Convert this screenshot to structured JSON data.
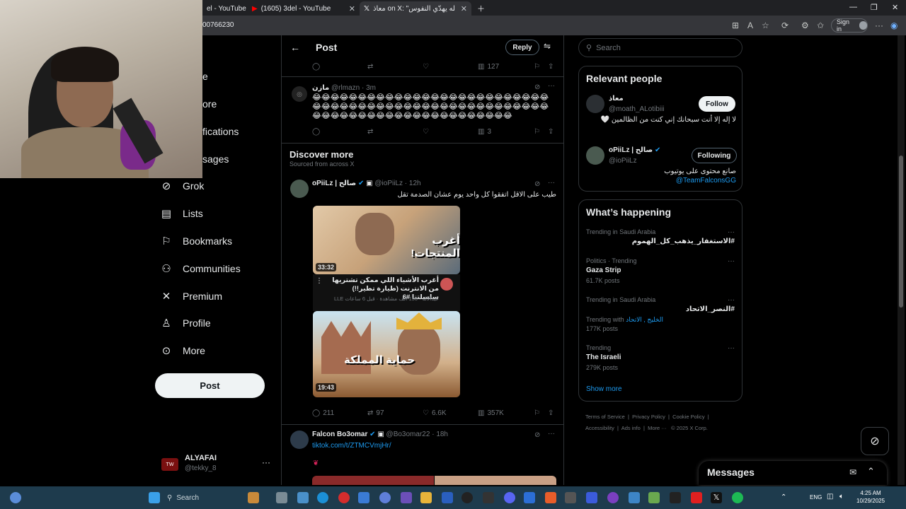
{
  "browser": {
    "tabs": [
      {
        "title": "el - YouTube",
        "icon": "youtube-icon"
      },
      {
        "title": "(1605) 3del - YouTube",
        "icon": "youtube-icon"
      },
      {
        "title": "معاذ on X: \"الله يهدّي النفوس\"",
        "icon": "x-icon"
      }
    ],
    "url": "00766230",
    "sign_in": "Sign in"
  },
  "sidebar": {
    "clipped_items": [
      "e",
      "ore",
      "fications",
      "sages"
    ],
    "items": [
      {
        "label": "Grok",
        "icon": "grok-icon"
      },
      {
        "label": "Lists",
        "icon": "list-icon"
      },
      {
        "label": "Bookmarks",
        "icon": "bookmark-icon"
      },
      {
        "label": "Communities",
        "icon": "communities-icon"
      },
      {
        "label": "Premium",
        "icon": "x-logo-icon"
      },
      {
        "label": "Profile",
        "icon": "profile-icon"
      },
      {
        "label": "More",
        "icon": "more-circle-icon"
      }
    ],
    "post_button": "Post",
    "account": {
      "name": "ALYAFAI",
      "handle": "@tekky_8"
    }
  },
  "header": {
    "title": "Post",
    "reply_button": "Reply"
  },
  "top_actions": {
    "views": "127"
  },
  "reply_tweet": {
    "name": "مازن",
    "handle": "@rlmazn",
    "time": "3m",
    "text": "😂😂😂😂😂😂😂😂😂😂😂😂😂😂😂😂😂😂😂😂😂😂😂😂😂😂😂😂😂😂😂😂😂😂😂😂😂😂😂😂😂😂😂😂😂😂😂😂😂😂😂😂😂😂😂😂😂😂😂😂😂😂😂😂😂😂😂😂😂😂😂😂😂😂",
    "views": "3"
  },
  "discover": {
    "title": "Discover more",
    "subtitle": "Sourced from across X"
  },
  "tweet1": {
    "name": "oPiiLz | صالح",
    "handle": "@ioPiiLz",
    "time": "12h",
    "text": "طيب على الاقل اتفقوا كل واحد يوم عشان الصدمة تقل",
    "video1": {
      "duration": "33:32",
      "title": "أغرب الأشياء اللي ممكن تشتريها من الانترنت (طيارة تطير!!) سلسلتنا #6",
      "meta": "عبدالاله · 156 ألف مشاهدة · قبل 6 ساعات LLE",
      "thumb_text": "أغرب المنتجات!"
    },
    "video2": {
      "duration": "19:43",
      "thumb_text": "حماية المملكة"
    },
    "replies": "211",
    "reposts": "97",
    "likes": "6.6K",
    "views": "357K"
  },
  "tweet2": {
    "name": "Falcon Bo3omar",
    "handle": "@Bo3omar22",
    "time": "18h",
    "link": "tiktok.com/t/ZTMCVmjHr/"
  },
  "right": {
    "search_placeholder": "Search",
    "relevant_people": {
      "title": "Relevant people",
      "people": [
        {
          "name": "معاذ",
          "handle": "@moath_ALotibiii",
          "bio": "لا إله إلا أنت سبحانك إني كنت من الظالمين 🤍",
          "button": "Follow"
        },
        {
          "name": "oPiiLz | صالح",
          "handle": "@ioPiiLz",
          "bio": "صانع محتوى على يوتيوب",
          "bio_link": "@TeamFalconsGG",
          "button": "Following"
        }
      ]
    },
    "happening": {
      "title": "What’s happening",
      "trends": [
        {
          "category": "Trending in Saudi Arabia",
          "name": "#الاستغفار_يذهب_كل_الهموم",
          "posts": ""
        },
        {
          "category": "Politics · Trending",
          "name": "Gaza Strip",
          "posts": "61.7K posts"
        },
        {
          "category": "Trending in Saudi Arabia",
          "name": "#النصر_الاتحاد",
          "with_label": "Trending with",
          "with_links": "الخليج , الاتحاد",
          "posts": "177K posts"
        },
        {
          "category": "Trending",
          "name": "The Israeli",
          "posts": "279K posts"
        }
      ],
      "show_more": "Show more"
    },
    "footer": [
      "Terms of Service",
      "Privacy Policy",
      "Cookie Policy",
      "Accessibility",
      "Ads info",
      "More ···",
      "© 2025 X Corp."
    ],
    "messages": "Messages"
  },
  "taskbar": {
    "search": "Search",
    "lang": "ENG",
    "time": "4:25 AM",
    "date": "10/29/2025"
  },
  "colors": {
    "accent": "#1d9bf0",
    "background": "#000000",
    "border": "#2f3336",
    "muted": "#71767b"
  }
}
